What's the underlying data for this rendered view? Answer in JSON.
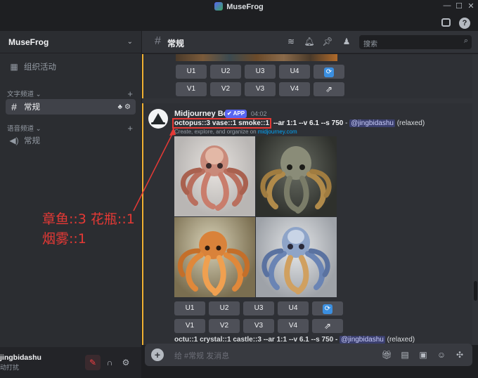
{
  "window": {
    "title": "MuseFrog",
    "controls": [
      "—",
      "☐",
      "✕"
    ],
    "tool_icons": [
      "inbox-icon",
      "help-icon"
    ]
  },
  "server": {
    "name": "MuseFrog"
  },
  "sidebar": {
    "events_label": "组织活动",
    "text_category": "文字频道",
    "text_channel": "常规",
    "voice_category": "语音频道",
    "voice_channel": "常规"
  },
  "user": {
    "name": "jingbidashu",
    "status": "动打扰"
  },
  "channel_header": {
    "name": "常规",
    "search_placeholder": "搜索"
  },
  "buttons": {
    "upscale": [
      "U1",
      "U2",
      "U3",
      "U4"
    ],
    "variation": [
      "V1",
      "V2",
      "V3",
      "V4"
    ],
    "refresh_icon": "refresh-icon",
    "open_icon": "external-link-icon"
  },
  "message": {
    "author": "Midjourney Bot",
    "badge": "✔ APP",
    "time": "04:02",
    "prompt_highlight": "octopus::3 vase::1 smoke::1",
    "prompt_params": " --ar 1:1 --v 6.1 --s 750",
    "separator": " - ",
    "mention": "@jingbidashu",
    "mode": " (relaxed)",
    "sub_text": "Create, explore, and organize on ",
    "sub_link": "midjourney.com"
  },
  "next_message": {
    "prompt": "octu::1 crystal::1 castle::3 --ar 1:1 --v 6.1 --s 750 - ",
    "mention": "@jingbidashu",
    "mode": " (relaxed)"
  },
  "annotation": {
    "line1": "章鱼::3 花瓶::1",
    "line2": "烟雾::1",
    "color": "#e53935"
  },
  "composer": {
    "placeholder": "给 #常规 发消息"
  },
  "colors": {
    "accent": "#5865f2",
    "mention_bar": "#f0b132",
    "highlight": "#e53935"
  }
}
